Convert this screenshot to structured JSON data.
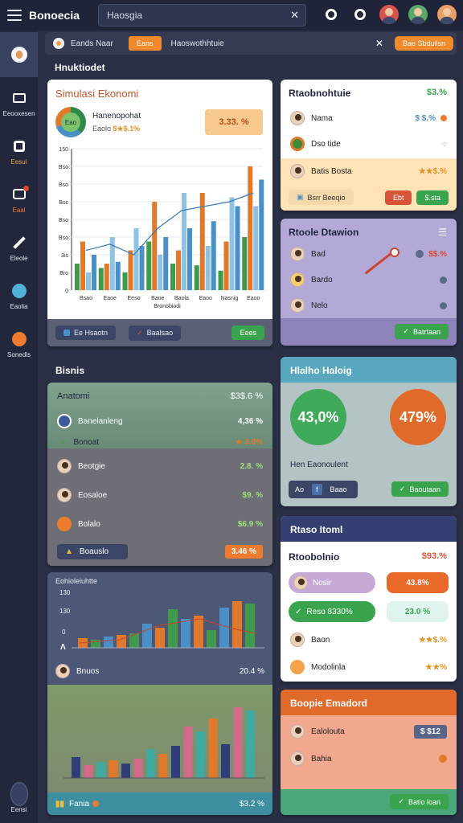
{
  "app": {
    "title": "Bonoecia"
  },
  "search": {
    "query": "Haosgia"
  },
  "notice": {
    "text": "Eands Naar",
    "chip": "Eans",
    "message": "Haoswothhtuie",
    "action": "Bae Sbduilsn"
  },
  "sidebar": {
    "items": [
      {
        "label": ""
      },
      {
        "label": "Eeooxesen"
      },
      {
        "label": "Eesui"
      },
      {
        "label": "Eaal"
      },
      {
        "label": "Eleole"
      },
      {
        "label": "Eaolia"
      },
      {
        "label": "Sonedls"
      },
      {
        "label": "Eensi"
      }
    ]
  },
  "sections": {
    "dashboard": "Hnuktiodet",
    "bisnis": "Bisnis"
  },
  "sim": {
    "title": "Simulasi Ekonomi",
    "subtitle": "Hanenopohat",
    "meta": "Eaolo",
    "meta_value": "$★$.1%",
    "badge": "3.33. %",
    "donut_label": "Eao",
    "legend": "Bronobiodi",
    "btn1": "Ee Hsaotn",
    "btn2": "Baalsao",
    "btn3": "Eees",
    "colors": {
      "green": "#3f9a4b",
      "orange": "#e07a2a",
      "blue": "#4a90c8",
      "paleBlue": "#8fc3e6"
    }
  },
  "chart_data": {
    "type": "bar",
    "categories": [
      "Bsao",
      "Eaoe",
      "Eeso",
      "Baoe",
      "Baola",
      "Eaoo",
      "Nasnig",
      "Eaoo"
    ],
    "yticks": [
      "150",
      "Bso",
      "Bso",
      "Bsc",
      "Bso",
      "Bso",
      "3is",
      "Bro",
      "0"
    ],
    "series": [
      {
        "values": [
          30,
          25,
          20,
          55,
          30,
          28,
          22,
          60
        ]
      },
      {
        "values": [
          55,
          30,
          45,
          100,
          45,
          110,
          55,
          140
        ]
      },
      {
        "values": [
          20,
          60,
          70,
          40,
          110,
          50,
          105,
          95
        ]
      },
      {
        "values": [
          40,
          32,
          50,
          60,
          70,
          78,
          95,
          125
        ]
      }
    ],
    "line": [
      45,
      52,
      40,
      70,
      90,
      95,
      100,
      110
    ],
    "ylim": [
      0,
      160
    ]
  },
  "rb1": {
    "title": "Rtaobnohtuie",
    "value": "$3.%",
    "rows": [
      {
        "name": "Nama",
        "value": "$ $.%"
      },
      {
        "name": "Dso tide",
        "value": "◌"
      },
      {
        "name": "Batis Bosta",
        "value": "★★$.%"
      }
    ],
    "btn1": "Bsrr Beeqio",
    "btn2": "Ebt",
    "btn3": "$.sta"
  },
  "rb2": {
    "title": "Rtoole Dtawion",
    "rows": [
      {
        "name": "Bad",
        "value": "$$.%"
      },
      {
        "name": "Bardo"
      },
      {
        "name": "Nelo"
      }
    ],
    "btn": "Batrtaan"
  },
  "rb3": {
    "title": "Hlalho Haloig",
    "g1": "43,0%",
    "g2": "479%",
    "label": "Hen Eaonoulent",
    "btn1": "Ao",
    "btn2": "Baao",
    "btn3": "Baoutaan"
  },
  "rb4": {
    "header": "Rtaso Itoml",
    "title": "Rtoobolnio",
    "value": "$93.%",
    "left1": "Nosir",
    "right1": "43.8%",
    "left2": "Reso 8330%",
    "right2": "23.0 %",
    "rows": [
      {
        "name": "Baon",
        "value": "★★$.%"
      },
      {
        "name": "Modolinla",
        "value": "★★%"
      }
    ]
  },
  "rb5": {
    "header": "Boopie Emadord",
    "rows": [
      {
        "name": "Ealolouta",
        "value": "$ $12"
      },
      {
        "name": "Bahia"
      }
    ],
    "btn": "Batio loan"
  },
  "bisnis": {
    "head": "Anatomi",
    "head_value": "$3$.6 %",
    "rows": [
      {
        "name": "Banelanleng",
        "value": "4,36 %"
      },
      {
        "name": "Bonoat",
        "value": "★ 3.0%"
      },
      {
        "name": "Beotgie",
        "value": "2.8. %"
      },
      {
        "name": "Eosaloe",
        "value": "$9. %"
      },
      {
        "name": "Bolalo",
        "value": "$6.9 %"
      },
      {
        "name": "Boauslo",
        "value": "3.46 %"
      }
    ]
  },
  "chart2": {
    "title": "Eohioleiuhtte",
    "yticks": [
      "130",
      "130",
      "0"
    ],
    "row_name": "Bnuos",
    "row_value": "20.4 %",
    "footer_name": "Fania",
    "footer_value": "$3.2 %"
  }
}
